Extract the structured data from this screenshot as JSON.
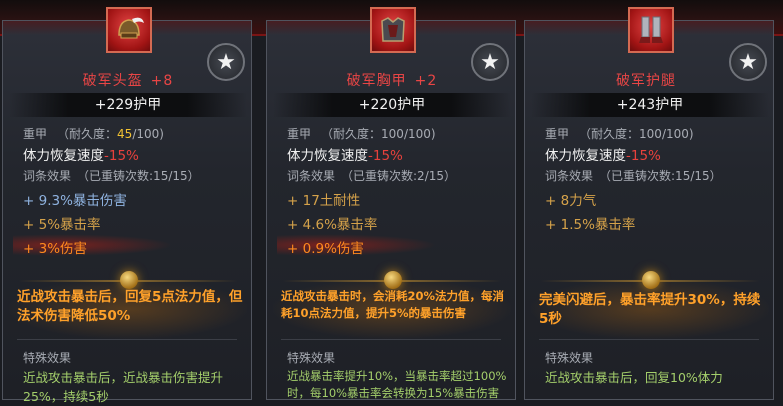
{
  "panels": [
    {
      "id": "p0",
      "icon": "helmet-icon",
      "name": "破军头盔",
      "level": "+8",
      "armor_value": "+229",
      "armor_label": "护甲",
      "type_label": "重甲",
      "durability_label": "（耐久度：",
      "durability_current": "45",
      "durability_max": "/100)",
      "stat_label": "体力恢复速度",
      "stat_value": "-15%",
      "affix_label": "词条效果",
      "reforge_text": "（已重铸次数:15/15）",
      "affixes": [
        {
          "text": "+ 9.3%暴击伤害",
          "color": "blue"
        },
        {
          "text": "+ 5%暴击率",
          "color": "gold"
        },
        {
          "text": "+ 3%伤害",
          "color": "orange"
        }
      ],
      "legendary": "近战攻击暴击后，回复5点法力值，但法术伤害降低50%",
      "special_label": "特殊效果",
      "special": "近战攻击暴击后，近战暴击伤害提升25%，持续5秒"
    },
    {
      "id": "p1",
      "icon": "chestplate-icon",
      "name": "破军胸甲",
      "level": "+2",
      "armor_value": "+220",
      "armor_label": "护甲",
      "type_label": "重甲",
      "durability_label": "（耐久度：",
      "durability_current": "100",
      "durability_max": "/100)",
      "stat_label": "体力恢复速度",
      "stat_value": "-15%",
      "affix_label": "词条效果",
      "reforge_text": "（已重铸次数:2/15）",
      "affixes": [
        {
          "text": "+ 17土耐性",
          "color": "gold"
        },
        {
          "text": "+ 4.6%暴击率",
          "color": "gold"
        },
        {
          "text": "+ 0.9%伤害",
          "color": "orange"
        }
      ],
      "legendary": "近战攻击暴击时，会消耗20%法力值，每消耗10点法力值，提升5%的暴击伤害",
      "special_label": "特殊效果",
      "special": "近战暴击率提升10%，当暴击率超过100%时，每10%暴击率会转换为15%暴击伤害"
    },
    {
      "id": "p2",
      "icon": "leg-armor-icon",
      "name": "破军护腿",
      "level": "",
      "armor_value": "+243",
      "armor_label": "护甲",
      "type_label": "重甲",
      "durability_label": "（耐久度：",
      "durability_current": "100",
      "durability_max": "/100)",
      "stat_label": "体力恢复速度",
      "stat_value": "-15%",
      "affix_label": "词条效果",
      "reforge_text": "（已重铸次数:15/15）",
      "affixes": [
        {
          "text": "+ 8力气",
          "color": "gold"
        },
        {
          "text": "+ 1.5%暴击率",
          "color": "gold"
        }
      ],
      "legendary": "完美闪避后，暴击率提升30%，持续5秒",
      "special_label": "特殊效果",
      "special": "近战攻击暴击后，回复10%体力"
    }
  ],
  "star_icon": "star-icon",
  "colors": {
    "title": "#e84545",
    "blue_affix": "#8fb3e0",
    "gold_affix": "#d5a24a",
    "orange_affix": "#ff8a1e",
    "legendary": "#ffa12a",
    "special": "#a4cf6b",
    "negative_stat": "#e8413c",
    "durability_low": "#f2c232"
  }
}
